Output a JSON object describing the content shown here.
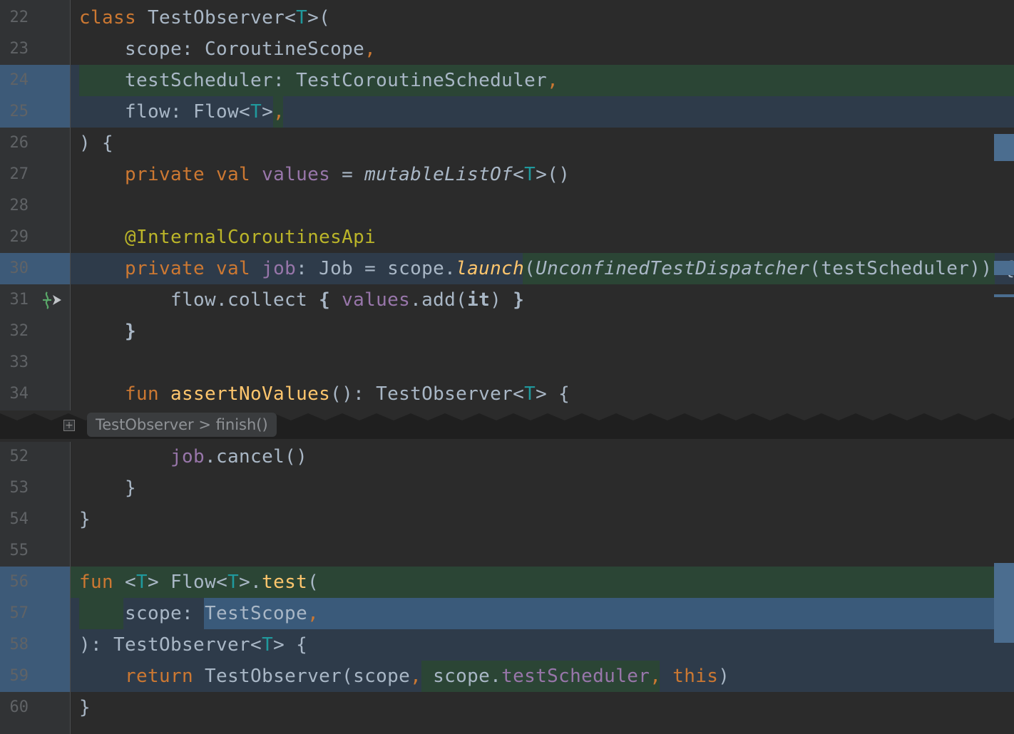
{
  "editor": {
    "lines": [
      {
        "num": "22",
        "segments": [
          [
            "kw",
            "class "
          ],
          [
            "ty",
            "TestObserver<"
          ],
          [
            "tp",
            "T"
          ],
          [
            "ty",
            ">("
          ]
        ]
      },
      {
        "num": "23",
        "segments": [
          [
            "ty",
            "    scope: CoroutineScope"
          ],
          [
            "pu",
            ","
          ]
        ]
      },
      {
        "num": "24",
        "segments": [
          [
            "ty",
            "    testScheduler: TestCoroutineScheduler"
          ],
          [
            "pu",
            ","
          ]
        ]
      },
      {
        "num": "25",
        "segments": [
          [
            "ty",
            "    flow: Flow<"
          ],
          [
            "tp",
            "T"
          ],
          [
            "ty",
            ">"
          ],
          [
            "pu",
            ","
          ]
        ]
      },
      {
        "num": "26",
        "segments": [
          [
            "ty",
            ") {"
          ]
        ]
      },
      {
        "num": "27",
        "segments": [
          [
            "kw",
            "    private val "
          ],
          [
            "pr",
            "values"
          ],
          [
            "ty",
            " = "
          ],
          [
            "it",
            "mutableListOf"
          ],
          [
            "ty",
            "<"
          ],
          [
            "tp",
            "T"
          ],
          [
            "ty",
            ">()"
          ]
        ]
      },
      {
        "num": "28",
        "segments": []
      },
      {
        "num": "29",
        "segments": [
          [
            "an",
            "    @InternalCoroutinesApi"
          ]
        ]
      },
      {
        "num": "30",
        "segments": [
          [
            "kw",
            "    private val "
          ],
          [
            "pr",
            "job"
          ],
          [
            "ty",
            ": Job = scope."
          ],
          [
            "itfn",
            "launch"
          ],
          [
            "ty",
            "("
          ],
          [
            "it",
            "UnconfinedTestDispatcher"
          ],
          [
            "ty",
            "(testScheduler)) {"
          ]
        ]
      },
      {
        "num": "31",
        "segments": [
          [
            "ty",
            "        flow.collect "
          ],
          [
            "bd",
            "{ "
          ],
          [
            "pr",
            "values"
          ],
          [
            "ty",
            ".add("
          ],
          [
            "bd",
            "it"
          ],
          [
            "ty",
            ") "
          ],
          [
            "bd",
            "}"
          ]
        ]
      },
      {
        "num": "32",
        "segments": [
          [
            "bd",
            "    }"
          ]
        ]
      },
      {
        "num": "33",
        "segments": []
      },
      {
        "num": "34",
        "segments": [
          [
            "kw",
            "    fun "
          ],
          [
            "fn",
            "assertNoValues"
          ],
          [
            "ty",
            "(): TestObserver<"
          ],
          [
            "tp",
            "T"
          ],
          [
            "ty",
            "> {"
          ]
        ]
      },
      {
        "num": "",
        "segments": []
      },
      {
        "num": "52",
        "segments": [
          [
            "pr",
            "        job"
          ],
          [
            "ty",
            ".cancel()"
          ]
        ]
      },
      {
        "num": "53",
        "segments": [
          [
            "ty",
            "    }"
          ]
        ]
      },
      {
        "num": "54",
        "segments": [
          [
            "ty",
            "}"
          ]
        ]
      },
      {
        "num": "55",
        "segments": []
      },
      {
        "num": "56",
        "segments": [
          [
            "kw",
            "fun "
          ],
          [
            "ty",
            "<"
          ],
          [
            "tp",
            "T"
          ],
          [
            "ty",
            "> Flow<"
          ],
          [
            "tp",
            "T"
          ],
          [
            "ty",
            ">."
          ],
          [
            "fn",
            "test"
          ],
          [
            "ty",
            "("
          ]
        ]
      },
      {
        "num": "57",
        "segments": [
          [
            "ty",
            "    scope: TestScope"
          ],
          [
            "pu",
            ","
          ]
        ]
      },
      {
        "num": "58",
        "segments": [
          [
            "ty",
            "): TestObserver<"
          ],
          [
            "tp",
            "T"
          ],
          [
            "ty",
            "> {"
          ]
        ]
      },
      {
        "num": "59",
        "segments": [
          [
            "kw",
            "    return "
          ],
          [
            "ty",
            "TestObserver(scope"
          ],
          [
            "pu",
            ", "
          ],
          [
            "ty",
            "scope."
          ],
          [
            "pr",
            "testScheduler"
          ],
          [
            "pu",
            ", "
          ],
          [
            "kw",
            "this"
          ],
          [
            "ty",
            ")"
          ]
        ]
      },
      {
        "num": "60",
        "segments": [
          [
            "ty",
            "}"
          ]
        ]
      }
    ]
  },
  "fold": {
    "breadcrumb_class": "TestObserver",
    "breadcrumb_sep": " > ",
    "breadcrumb_method": "finish()",
    "toggle_symbol": "+"
  },
  "colors": {
    "background": "#2b2b2b",
    "gutter": "#313335",
    "line_number": "#606366",
    "keyword": "#cc7832",
    "type_param": "#20999d",
    "property": "#9876aa",
    "function": "#ffc66d",
    "annotation": "#bbb529",
    "changed_gutter": "#3d5a78",
    "changed_line": "#2e3b4a",
    "inserted": "#2b4535"
  },
  "icons": {
    "gutter_31": "coroutine-suspend-call-icon",
    "fold_toggle": "expand-fold-icon"
  }
}
